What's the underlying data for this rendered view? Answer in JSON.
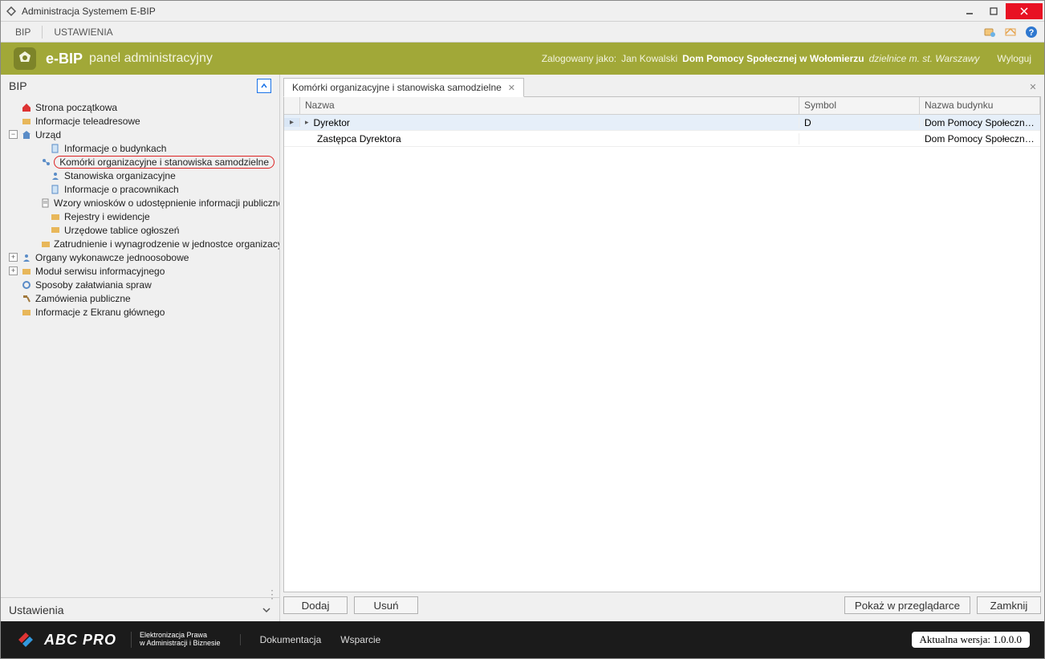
{
  "window": {
    "title": "Administracja Systemem E-BIP"
  },
  "menu": {
    "items": [
      "BIP",
      "USTAWIENIA"
    ]
  },
  "banner": {
    "title": "e-BIP",
    "subtitle": "panel administracyjny",
    "logged_label": "Zalogowany jako:",
    "user": "Jan Kowalski",
    "org": "Dom Pomocy Społecznej w Wołomierzu",
    "org_suffix": "dzielnice m. st. Warszawy",
    "logout": "Wyloguj"
  },
  "sidebar": {
    "header": "BIP",
    "footer": "Ustawienia",
    "nodes": {
      "start": "Strona początkowa",
      "info_tele": "Informacje teleadresowe",
      "urzad": "Urząd",
      "budynki": "Informacje o budynkach",
      "komorki": "Komórki organizacyjne i stanowiska samodzielne",
      "stanowiska": "Stanowiska organizacyjne",
      "pracownicy": "Informacje o pracownikach",
      "wzory": "Wzory wniosków o udostępnienie informacji publicznej",
      "rejestry": "Rejestry i ewidencje",
      "tablice": "Urzędowe tablice ogłoszeń",
      "zatrudnienie": "Zatrudnienie i wynagrodzenie w jednostce organizacyj",
      "organy": "Organy wykonawcze jednoosobowe",
      "modul": "Moduł serwisu informacyjnego",
      "sposoby": "Sposoby załatwiania spraw",
      "zamowienia": "Zamówienia publiczne",
      "ekran": "Informacje z Ekranu głównego"
    }
  },
  "tab": {
    "title": "Komórki organizacyjne i stanowiska samodzielne"
  },
  "grid": {
    "headers": {
      "name": "Nazwa",
      "symbol": "Symbol",
      "building": "Nazwa budynku"
    },
    "rows": [
      {
        "name": "Dyrektor",
        "symbol": "D",
        "building": "Dom Pomocy Społecznej ..."
      },
      {
        "name": "Zastępca Dyrektora",
        "symbol": "",
        "building": "Dom Pomocy Społecznej ..."
      }
    ]
  },
  "buttons": {
    "add": "Dodaj",
    "remove": "Usuń",
    "preview": "Pokaż w przeglądarce",
    "close": "Zamknij"
  },
  "footer": {
    "brand": "ABC PRO",
    "sub1": "Elektronizacja Prawa",
    "sub2": "w Administracji i Biznesie",
    "doc": "Dokumentacja",
    "support": "Wsparcie",
    "version_label": "Aktualna wersja:",
    "version": "1.0.0.0"
  }
}
